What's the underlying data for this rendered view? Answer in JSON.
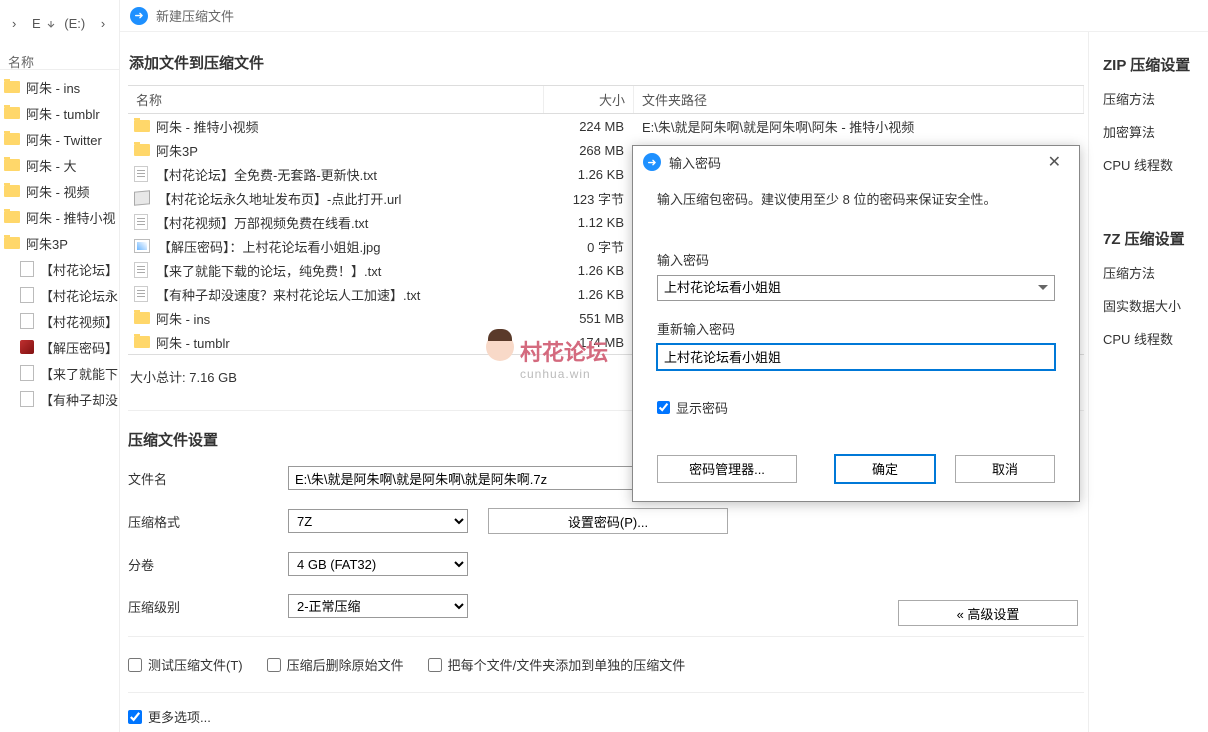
{
  "explorer": {
    "breadcrumb_e": "E",
    "breadcrumb_drive": " (E:)",
    "breadcrumb_sep": "›",
    "col_name": "名称",
    "items": [
      {
        "type": "folder",
        "label": "阿朱 - ins"
      },
      {
        "type": "folder",
        "label": "阿朱 - tumblr"
      },
      {
        "type": "folder",
        "label": "阿朱 - Twitter"
      },
      {
        "type": "folder",
        "label": "阿朱 - 大"
      },
      {
        "type": "folder",
        "label": "阿朱 - 视频"
      },
      {
        "type": "folder",
        "label": "阿朱 - 推特小视"
      },
      {
        "type": "folder",
        "label": "阿朱3P"
      },
      {
        "type": "file",
        "label": "【村花论坛】",
        "indent": true
      },
      {
        "type": "file",
        "label": "【村花论坛永",
        "indent": true
      },
      {
        "type": "file",
        "label": "【村花视频】",
        "indent": true
      },
      {
        "type": "img",
        "label": "【解压密码】",
        "indent": true
      },
      {
        "type": "file",
        "label": "【来了就能下",
        "indent": true
      },
      {
        "type": "file",
        "label": "【有种子却没",
        "indent": true
      }
    ]
  },
  "archive": {
    "window_title": "新建压缩文件",
    "section_add": "添加文件到压缩文件",
    "col_name": "名称",
    "col_size": "大小",
    "col_path": "文件夹路径",
    "rows": [
      {
        "icon": "folder",
        "name": "阿朱 - 推特小视频",
        "size": "224 MB",
        "path": "E:\\朱\\就是阿朱啊\\就是阿朱啊\\阿朱 - 推特小视频"
      },
      {
        "icon": "folder",
        "name": "阿朱3P",
        "size": "268 MB",
        "path": ""
      },
      {
        "icon": "txt",
        "name": "【村花论坛】全免费-无套路-更新快.txt",
        "size": "1.26 KB",
        "path": ""
      },
      {
        "icon": "url",
        "name": "【村花论坛永久地址发布页】-点此打开.url",
        "size": "123 字节",
        "path": ""
      },
      {
        "icon": "txt",
        "name": "【村花视频】万部视频免费在线看.txt",
        "size": "1.12 KB",
        "path": ""
      },
      {
        "icon": "jpg",
        "name": "【解压密码】：上村花论坛看小姐姐.jpg",
        "size": "0 字节",
        "path": ""
      },
      {
        "icon": "txt",
        "name": "【来了就能下载的论坛，纯免费！】.txt",
        "size": "1.26 KB",
        "path": ""
      },
      {
        "icon": "txt",
        "name": "【有种子却没速度？来村花论坛人工加速】.txt",
        "size": "1.26 KB",
        "path": ""
      },
      {
        "icon": "folder",
        "name": "阿朱 - ins",
        "size": "551 MB",
        "path": ""
      },
      {
        "icon": "folder",
        "name": "阿朱 - tumblr",
        "size": "174 MB",
        "path": ""
      }
    ],
    "total_label": "大小总计: 7.16 GB",
    "settings_title": "压缩文件设置",
    "filename_label": "文件名",
    "filename_value": "E:\\朱\\就是阿朱啊\\就是阿朱啊\\就是阿朱啊.7z",
    "format_label": "压缩格式",
    "format_value": "7Z",
    "setpwd_btn": "设置密码(P)...",
    "volume_label": "分卷",
    "volume_value": "4 GB (FAT32)",
    "level_label": "压缩级别",
    "level_value": "2-正常压缩",
    "chk_test": "测试压缩文件(T)",
    "chk_delete": "压缩后删除原始文件",
    "chk_each": "把每个文件/文件夹添加到单独的压缩文件",
    "more": "更多选项...",
    "advanced_btn": "« 高级设置"
  },
  "rightpanel": {
    "zip_title": "ZIP 压缩设置",
    "zip_items": [
      "压缩方法",
      "加密算法",
      "CPU 线程数"
    ],
    "sz_title": "7Z 压缩设置",
    "sz_items": [
      "压缩方法",
      "固实数据大小",
      "CPU 线程数"
    ]
  },
  "dialog": {
    "title": "输入密码",
    "message": "输入压缩包密码。建议使用至少 8 位的密码来保证安全性。",
    "pwd_label": "输入密码",
    "pwd_value": "上村花论坛看小姐姐",
    "repwd_label": "重新输入密码",
    "repwd_value": "上村花论坛看小姐姐",
    "show_pwd": "显示密码",
    "pwd_manager": "密码管理器...",
    "ok": "确定",
    "cancel": "取消"
  },
  "watermark": {
    "line1": "村花论坛",
    "line2": "cunhua.win"
  }
}
